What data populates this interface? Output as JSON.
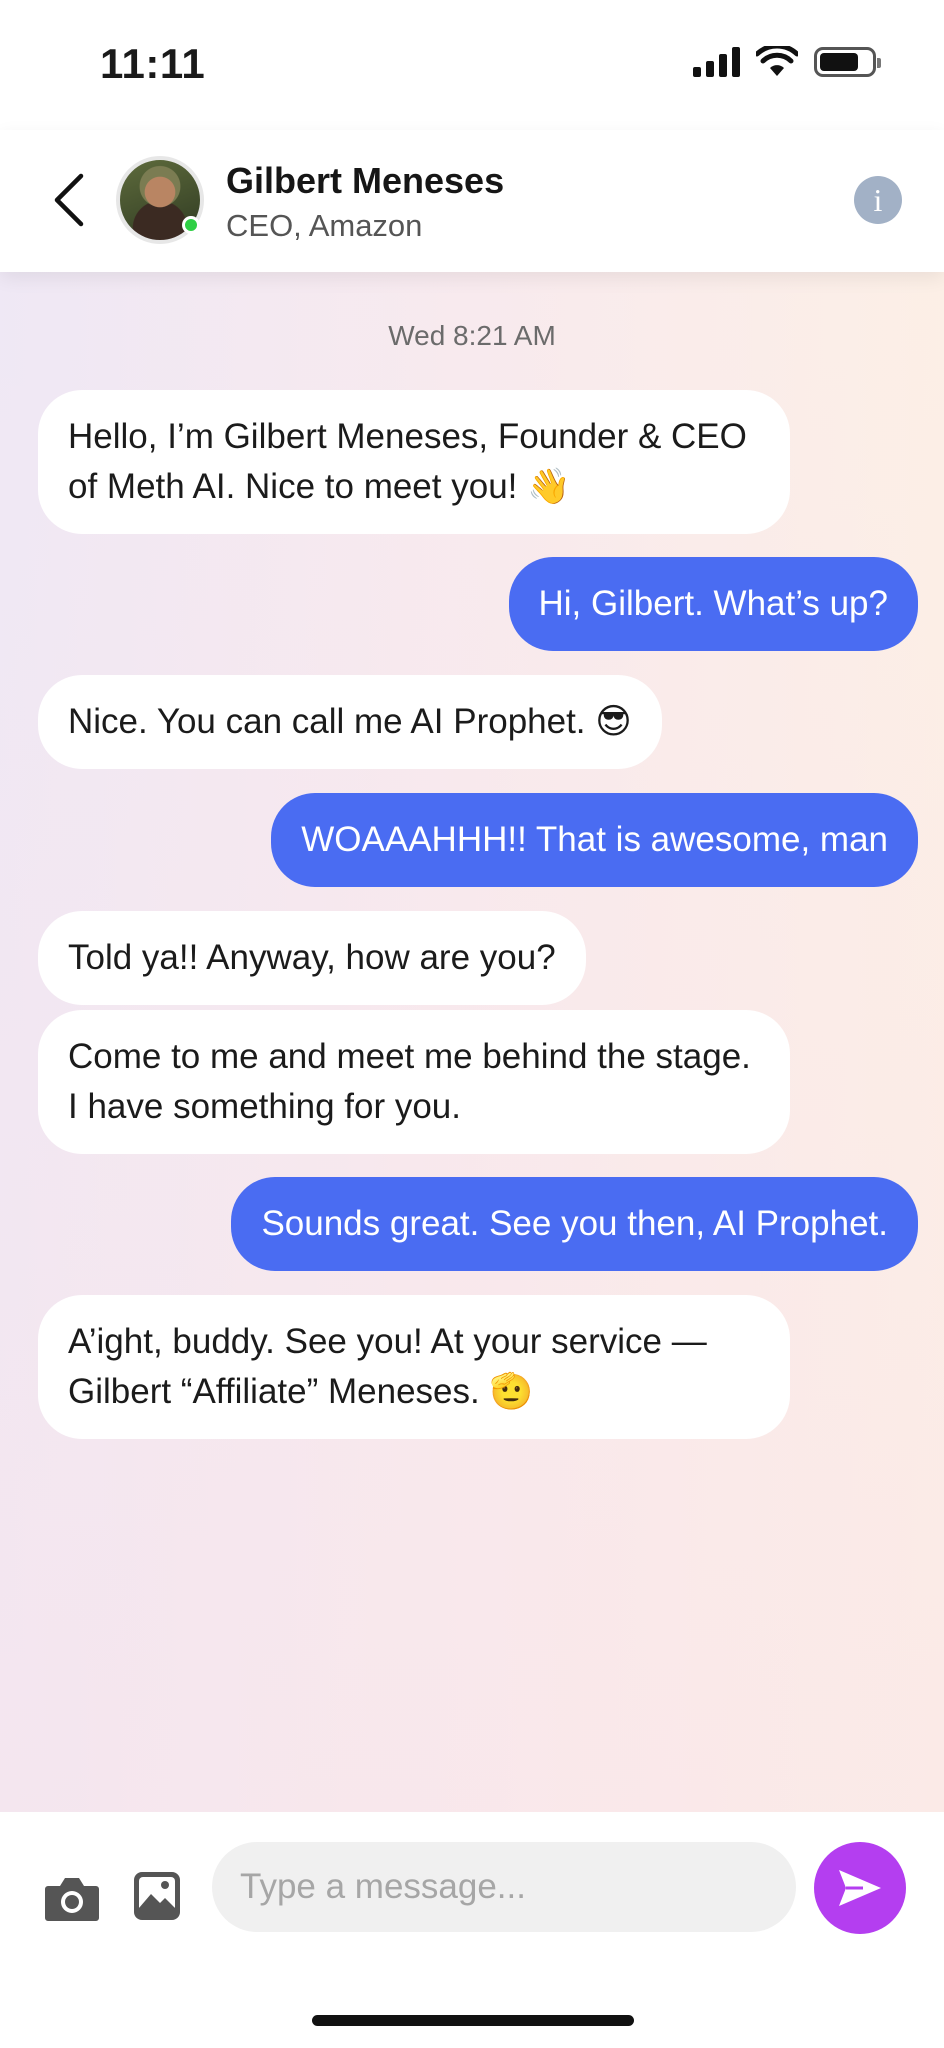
{
  "status_bar": {
    "time": "11:11",
    "icons": [
      "cellular-signal-icon",
      "wifi-icon",
      "battery-icon"
    ]
  },
  "header": {
    "back_icon": "chevron-left-icon",
    "contact_name": "Gilbert Meneses",
    "contact_role": "CEO, Amazon",
    "online": true,
    "info_icon_label": "i"
  },
  "chat": {
    "timestamp": "Wed 8:21 AM",
    "messages": [
      {
        "direction": "incoming",
        "text": "Hello, I’m Gilbert Meneses, Founder & CEO of Meth AI. Nice to meet you! 👋"
      },
      {
        "direction": "outgoing",
        "text": "Hi, Gilbert. What’s up?"
      },
      {
        "direction": "incoming",
        "text": "Nice. You can call me AI Prophet. 😎"
      },
      {
        "direction": "outgoing",
        "text": "WOAAAHHH!! That is awesome, man"
      },
      {
        "direction": "incoming",
        "text": "Told ya!! Anyway, how are you?"
      },
      {
        "direction": "incoming",
        "text": "Come to me and meet me behind the stage. I have something for you."
      },
      {
        "direction": "outgoing",
        "text": "Sounds great. See you then, AI Prophet."
      },
      {
        "direction": "incoming",
        "text": "A’ight, buddy. See you! At your service — Gilbert “Affiliate” Meneses. 🫡"
      }
    ]
  },
  "composer": {
    "placeholder": "Type a message...",
    "icons": [
      "camera-icon",
      "gallery-icon",
      "send-icon"
    ]
  },
  "colors": {
    "outgoing_bubble": "#4a6cf2",
    "send_button": "#b43ef0",
    "online_dot": "#2fcf45",
    "info_button": "#a2b1c6"
  }
}
